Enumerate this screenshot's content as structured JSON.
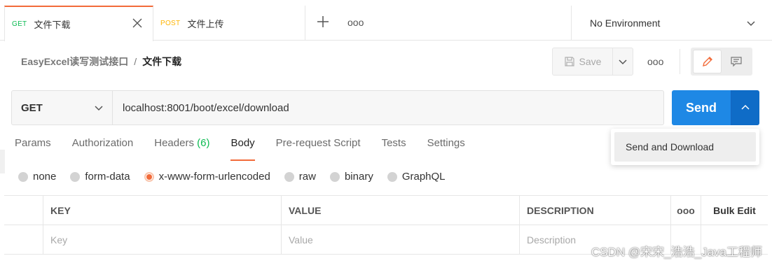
{
  "tabs": [
    {
      "method": "GET",
      "name": "文件下载"
    },
    {
      "method": "POST",
      "name": "文件上传"
    }
  ],
  "tab_more": "ooo",
  "environment": "No Environment",
  "breadcrumb": {
    "collection": "EasyExcel读写测试接口",
    "separator": "/",
    "request": "文件下载"
  },
  "toolbar": {
    "save_label": "Save",
    "more": "ooo"
  },
  "request": {
    "method": "GET",
    "url": "localhost:8001/boot/excel/download"
  },
  "send": {
    "label": "Send",
    "dropdown_item": "Send and Download"
  },
  "subtabs": [
    {
      "label": "Params"
    },
    {
      "label": "Authorization"
    },
    {
      "label": "Headers",
      "count": "(6)"
    },
    {
      "label": "Body"
    },
    {
      "label": "Pre-request Script"
    },
    {
      "label": "Tests"
    },
    {
      "label": "Settings"
    }
  ],
  "body_types": [
    "none",
    "form-data",
    "x-www-form-urlencoded",
    "raw",
    "binary",
    "GraphQL"
  ],
  "selected_body_type": "x-www-form-urlencoded",
  "table": {
    "headers": {
      "key": "KEY",
      "value": "VALUE",
      "description": "DESCRIPTION",
      "more": "ooo",
      "bulk": "Bulk Edit"
    },
    "placeholders": {
      "key": "Key",
      "value": "Value",
      "description": "Description"
    }
  },
  "watermark": "CSDN @宋宋_浩浩_Java工程师",
  "colors": {
    "accent": "#f26b3a",
    "send": "#1e88e5",
    "get": "#0cbb52",
    "post": "#ffb400"
  }
}
